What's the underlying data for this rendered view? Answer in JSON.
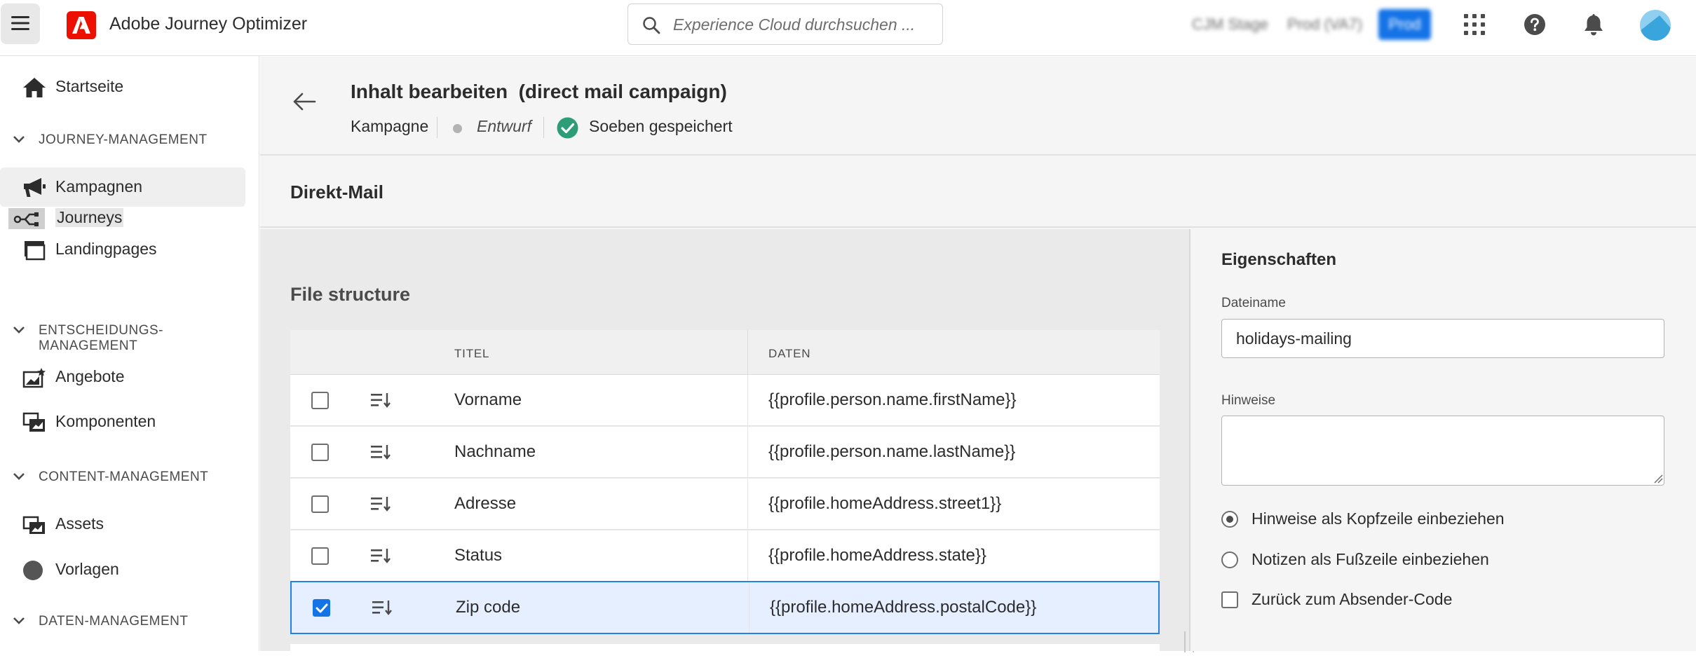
{
  "app": {
    "name": "Adobe Journey Optimizer"
  },
  "search": {
    "placeholder": "Experience Cloud durchsuchen ..."
  },
  "topbar": {
    "env_org": "CJM Stage",
    "env_sandbox": "Prod (VA7)",
    "env_button": "Prod"
  },
  "sidebar": {
    "home": "Startseite",
    "sections": {
      "journey": "JOURNEY-MANAGEMENT",
      "decision": "ENTSCHEIDUNGS-MANAGEMENT",
      "content": "CONTENT-MANAGEMENT",
      "data": "DATEN-MANAGEMENT"
    },
    "items": {
      "campaigns": "Kampagnen",
      "journeys": "Journeys",
      "landingpages": "Landingpages",
      "offers": "Angebote",
      "components": "Komponenten",
      "assets": "Assets",
      "templates": "Vorlagen"
    }
  },
  "header": {
    "title": "Inhalt bearbeiten  (direct mail campaign)",
    "type": "Kampagne",
    "status": "Entwurf",
    "saved": "Soeben gespeichert"
  },
  "channel": {
    "title": "Direkt-Mail"
  },
  "file_structure": {
    "title": "File structure",
    "columns": {
      "title": "TITEL",
      "data": "DATEN"
    },
    "rows": [
      {
        "title": "Vorname",
        "data": "{{profile.person.name.firstName}}",
        "checked": false
      },
      {
        "title": "Nachname",
        "data": "{{profile.person.name.lastName}}",
        "checked": false
      },
      {
        "title": "Adresse",
        "data": "{{profile.homeAddress.street1}}",
        "checked": false
      },
      {
        "title": "Status",
        "data": "{{profile.homeAddress.state}}",
        "checked": false
      },
      {
        "title": "Zip code",
        "data": "{{profile.homeAddress.postalCode}}",
        "checked": true
      }
    ]
  },
  "properties": {
    "title": "Eigenschaften",
    "filename_label": "Dateiname",
    "filename_value": "holidays-mailing",
    "notes_label": "Hinweise",
    "notes_value": "",
    "options": {
      "header": "Hinweise als Kopfzeile einbeziehen",
      "footer": "Notizen als Fußzeile einbeziehen",
      "return_code": "Zurück zum Absender-Code"
    }
  },
  "colors": {
    "accent": "#1473e6",
    "adobe_red": "#eb1000",
    "saved_green": "#2d9d78",
    "selected_row": "#e5efff"
  }
}
